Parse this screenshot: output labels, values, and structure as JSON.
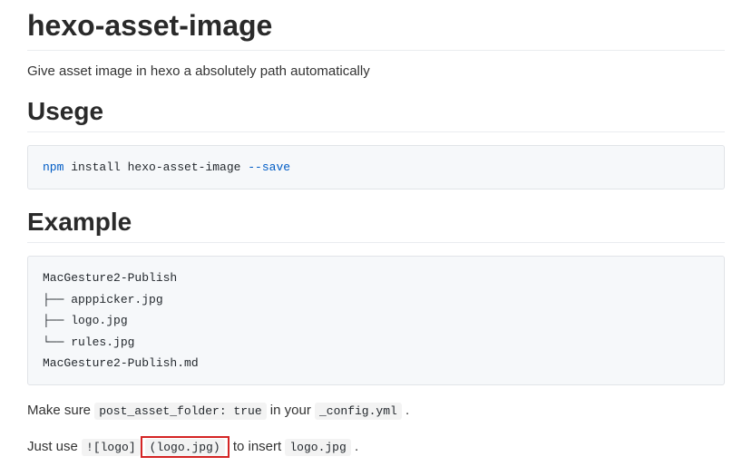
{
  "title": "hexo-asset-image",
  "description": "Give asset image in hexo a absolutely path automatically",
  "sections": {
    "usage": {
      "heading": "Usege",
      "install_cmd_prefix": "npm",
      "install_cmd_rest": " install hexo-asset-image ",
      "install_cmd_flag": "--save"
    },
    "example": {
      "heading": "Example",
      "tree": "MacGesture2-Publish\n├── apppicker.jpg\n├── logo.jpg\n└── rules.jpg\nMacGesture2-Publish.md",
      "make_sure_pre": "Make sure ",
      "make_sure_code": "post_asset_folder: true",
      "make_sure_mid": " in your ",
      "make_sure_config": "_config.yml",
      "make_sure_post": " .",
      "just_use_pre": "Just use ",
      "just_use_code1": "![logo]",
      "just_use_code2": "(logo.jpg)",
      "just_use_mid": " to insert ",
      "just_use_logo": "logo.jpg",
      "just_use_post": " ."
    }
  }
}
